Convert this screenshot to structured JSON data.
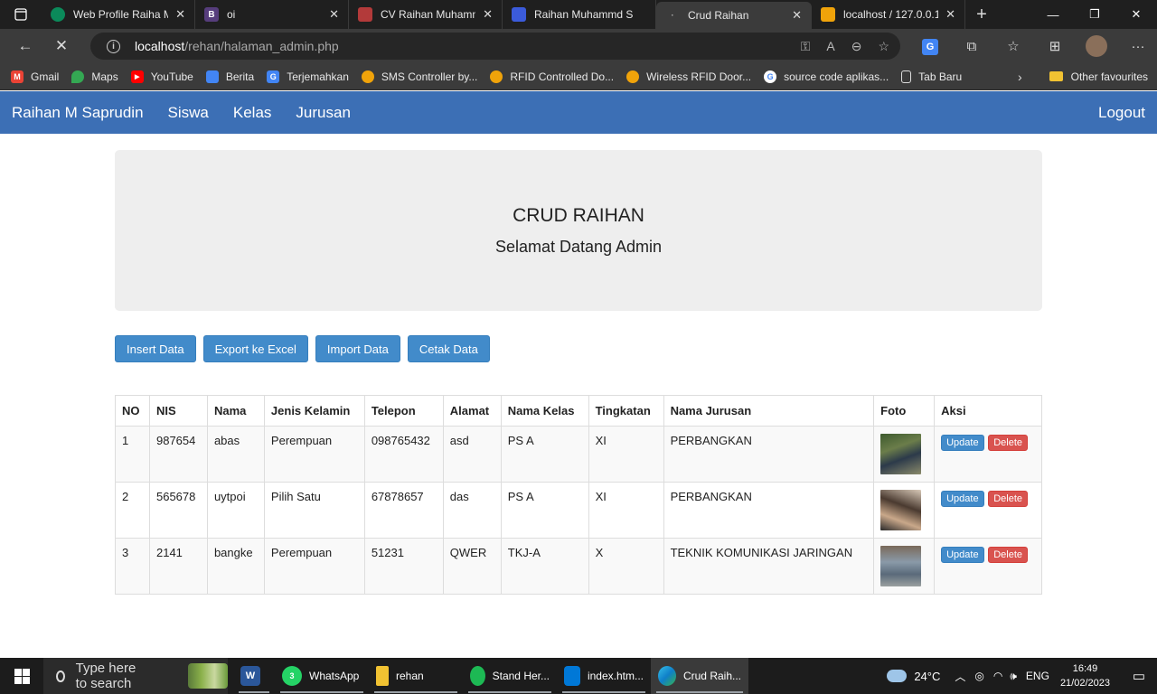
{
  "browser": {
    "tabs": [
      {
        "title": "Web Profile Raiha M",
        "color": "#0b8a5a",
        "glyph": ""
      },
      {
        "title": "oi",
        "color": "#563d7c",
        "glyph": "B"
      },
      {
        "title": "CV Raihan Muhamm",
        "color": "#b33a3a",
        "glyph": ""
      },
      {
        "title": "Raihan Muhammd S",
        "color": "#3b5bdb",
        "glyph": ""
      },
      {
        "title": "Crud Raihan",
        "color": "#3b3b3b",
        "glyph": "·"
      },
      {
        "title": "localhost / 127.0.0.1",
        "color": "#f0a30a",
        "glyph": ""
      }
    ],
    "url_host": "localhost",
    "url_path": "/rehan/halaman_admin.php",
    "bookmarks": [
      {
        "label": "Gmail",
        "color": "#ea4335",
        "glyph": "M"
      },
      {
        "label": "Maps",
        "color": "#34a853",
        "glyph": ""
      },
      {
        "label": "YouTube",
        "color": "#ff0000",
        "glyph": "▶"
      },
      {
        "label": "Berita",
        "color": "#4285f4",
        "glyph": ""
      },
      {
        "label": "Terjemahkan",
        "color": "#4285f4",
        "glyph": "G"
      },
      {
        "label": "SMS Controller by...",
        "color": "#f0a30a",
        "glyph": ""
      },
      {
        "label": "RFID Controlled Do...",
        "color": "#f0a30a",
        "glyph": ""
      },
      {
        "label": "Wireless RFID Door...",
        "color": "#f0a30a",
        "glyph": ""
      },
      {
        "label": "source code aplikas...",
        "color": "#ffffff",
        "glyph": "G"
      },
      {
        "label": "Tab Baru",
        "color": "#3b3b3b",
        "glyph": ""
      }
    ],
    "other_favourites": "Other favourites"
  },
  "navbar": {
    "brand": "Raihan M Saprudin",
    "links": [
      "Siswa",
      "Kelas",
      "Jurusan"
    ],
    "logout": "Logout"
  },
  "jumbotron": {
    "title": "CRUD RAIHAN",
    "subtitle": "Selamat Datang Admin"
  },
  "actions": {
    "insert": "Insert Data",
    "export": "Export ke Excel",
    "import": "Import Data",
    "print": "Cetak Data"
  },
  "table": {
    "headers": [
      "NO",
      "NIS",
      "Nama",
      "Jenis Kelamin",
      "Telepon",
      "Alamat",
      "Nama Kelas",
      "Tingkatan",
      "Nama Jurusan",
      "Foto",
      "Aksi"
    ],
    "update_label": "Update",
    "delete_label": "Delete",
    "rows": [
      {
        "no": "1",
        "nis": "987654",
        "nama": "abas",
        "jk": "Perempuan",
        "telepon": "098765432",
        "alamat": "asd",
        "kelas": "PS A",
        "tingkatan": "XI",
        "jurusan": "PERBANGKAN"
      },
      {
        "no": "2",
        "nis": "565678",
        "nama": "uytpoi",
        "jk": "Pilih Satu",
        "telepon": "67878657",
        "alamat": "das",
        "kelas": "PS A",
        "tingkatan": "XI",
        "jurusan": "PERBANGKAN"
      },
      {
        "no": "3",
        "nis": "2141",
        "nama": "bangke",
        "jk": "Perempuan",
        "telepon": "51231",
        "alamat": "QWER",
        "kelas": "TKJ-A",
        "tingkatan": "X",
        "jurusan": "TEKNIK KOMUNIKASI JARINGAN"
      }
    ]
  },
  "taskbar": {
    "search_placeholder": "Type here to search",
    "apps": [
      {
        "label": "",
        "color": "#2b579a",
        "glyph": "W"
      },
      {
        "label": "WhatsApp",
        "color": "#25d366",
        "glyph": "3"
      },
      {
        "label": "rehan",
        "color": "#f1c232",
        "glyph": ""
      },
      {
        "label": "Stand Her...",
        "color": "#1db954",
        "glyph": ""
      },
      {
        "label": "index.htm...",
        "color": "#0078d7",
        "glyph": ""
      },
      {
        "label": "Crud Raih...",
        "color": "#0f7fc8",
        "glyph": ""
      }
    ],
    "weather": "24°C",
    "language": "ENG",
    "time": "16:49",
    "date": "21/02/2023"
  }
}
